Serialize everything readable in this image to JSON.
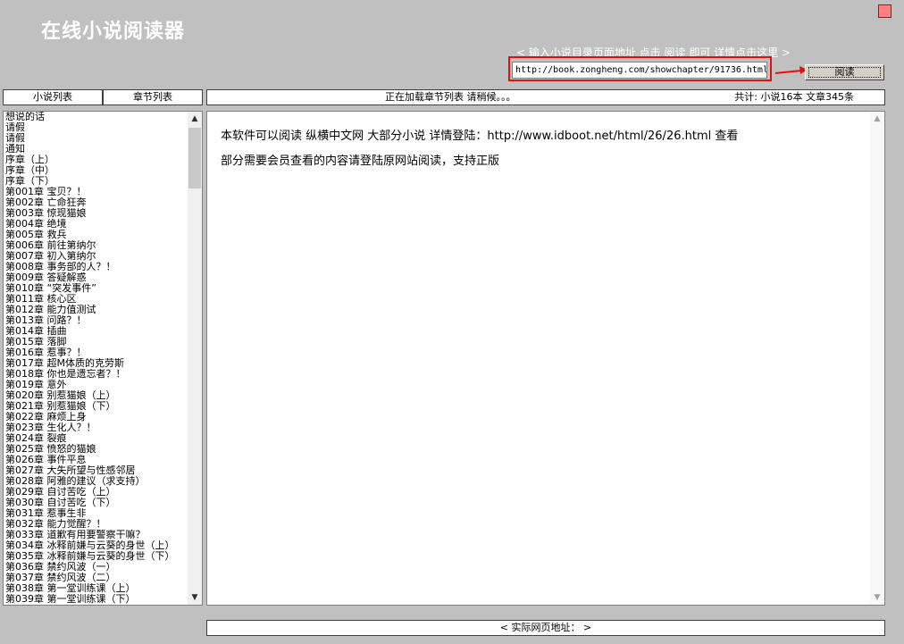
{
  "app": {
    "title": "在线小说阅读器"
  },
  "header": {
    "hint": "< 输入小说目录页面地址 点击 阅读 即可 详情点击这里 >",
    "url_value": "http://book.zongheng.com/showchapter/91736.html",
    "read_button": "阅读"
  },
  "tabs": {
    "novels": "小说列表",
    "chapters": "章节列表"
  },
  "status": {
    "loading": "正在加载章节列表 请稍候。。。",
    "counts": "共计: 小说16本   文章345条"
  },
  "chapters": [
    "想说的话",
    "请假",
    "请假",
    "通知",
    "序章（上）",
    "序章（中）",
    "序章（下）",
    "第001章  宝贝？！",
    "第002章 亡命狂奔",
    "第003章  惊现猫娘",
    "第004章  绝境",
    "第005章  救兵",
    "第006章 前往第纳尔",
    "第007章  初入第纳尔",
    "第008章  事务部的人？！",
    "第009章 答疑解惑",
    "第010章   “突发事件”",
    "第011章  核心区",
    "第012章  能力值测试",
    "第013章 问路？！",
    "第014章 插曲",
    "第015章  落脚",
    "第016章  惹事？！",
    "第017章  超M体质的克劳斯",
    "第018章  你也是遗忘者？！",
    "第019章  意外",
    "第020章 别惹猫娘（上）",
    "第021章 别惹猫娘（下）",
    "第022章  麻烦上身",
    "第023章  生化人？！",
    "第024章  裂痕",
    "第025章  愤怒的猫娘",
    "第026章 事件平息",
    "第027章  大失所望与性感邻居",
    "第028章  阿雅的建议（求支持）",
    "第029章  自讨苦吃（上）",
    "第030章  自讨苦吃（下）",
    "第031章  惹事生非",
    "第032章  能力觉醒？！",
    "第033章  道歉有用要警察干嘛？",
    "第034章  冰释前嫌与云葵的身世（上）",
    "第035章  冰释前嫌与云葵的身世（下）",
    "第036章  禁约风波（一）",
    "第037章  禁约风波（二）",
    "第038章 第一堂训练课（上）",
    "第039章 第一堂训练课（下）"
  ],
  "content": {
    "line1": "本软件可以阅读 纵横中文网 大部分小说 详情登陆：http://www.idboot.net/html/26/26.html 查看",
    "line2": "部分需要会员查看的内容请登陆原网站阅读，支持正版"
  },
  "footer": {
    "url_label": "< 实际网页地址： >"
  },
  "colors": {
    "background": "#c0c0c0",
    "highlight_frame": "#e01010",
    "close_button": "#ff8080"
  }
}
